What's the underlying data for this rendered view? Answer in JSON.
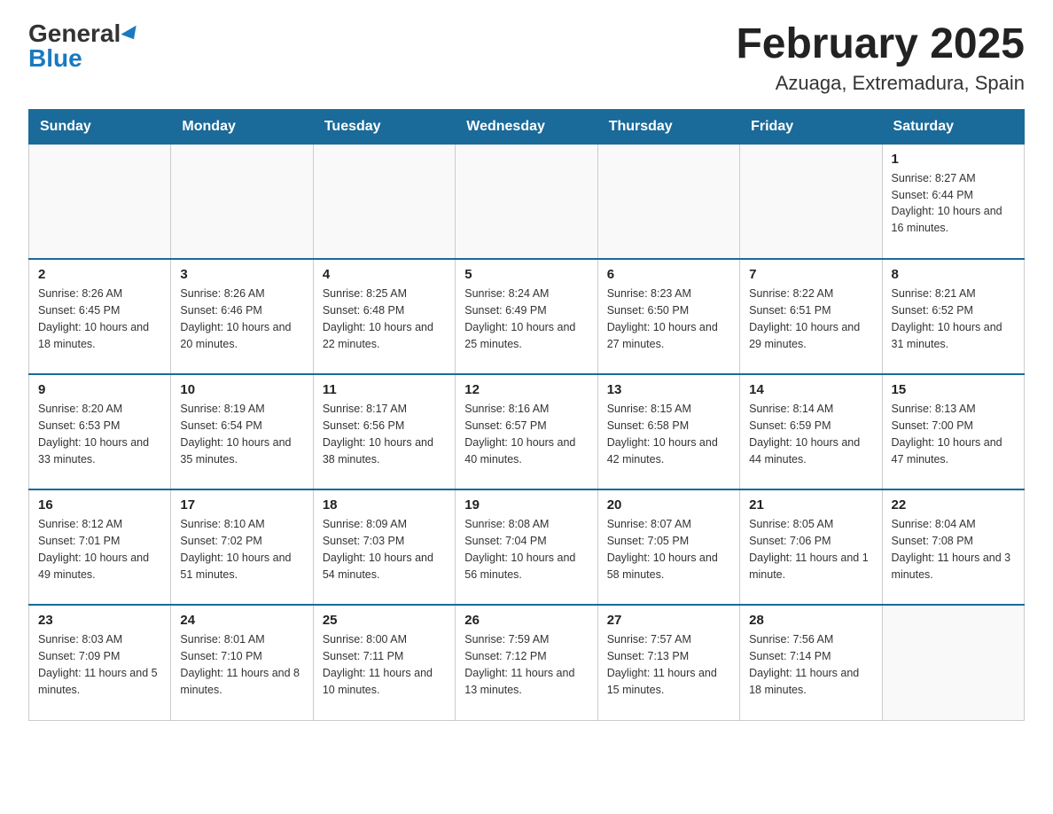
{
  "logo": {
    "general": "General",
    "blue": "Blue"
  },
  "title": "February 2025",
  "location": "Azuaga, Extremadura, Spain",
  "weekdays": [
    "Sunday",
    "Monday",
    "Tuesday",
    "Wednesday",
    "Thursday",
    "Friday",
    "Saturday"
  ],
  "weeks": [
    [
      {
        "day": "",
        "info": ""
      },
      {
        "day": "",
        "info": ""
      },
      {
        "day": "",
        "info": ""
      },
      {
        "day": "",
        "info": ""
      },
      {
        "day": "",
        "info": ""
      },
      {
        "day": "",
        "info": ""
      },
      {
        "day": "1",
        "info": "Sunrise: 8:27 AM\nSunset: 6:44 PM\nDaylight: 10 hours and 16 minutes."
      }
    ],
    [
      {
        "day": "2",
        "info": "Sunrise: 8:26 AM\nSunset: 6:45 PM\nDaylight: 10 hours and 18 minutes."
      },
      {
        "day": "3",
        "info": "Sunrise: 8:26 AM\nSunset: 6:46 PM\nDaylight: 10 hours and 20 minutes."
      },
      {
        "day": "4",
        "info": "Sunrise: 8:25 AM\nSunset: 6:48 PM\nDaylight: 10 hours and 22 minutes."
      },
      {
        "day": "5",
        "info": "Sunrise: 8:24 AM\nSunset: 6:49 PM\nDaylight: 10 hours and 25 minutes."
      },
      {
        "day": "6",
        "info": "Sunrise: 8:23 AM\nSunset: 6:50 PM\nDaylight: 10 hours and 27 minutes."
      },
      {
        "day": "7",
        "info": "Sunrise: 8:22 AM\nSunset: 6:51 PM\nDaylight: 10 hours and 29 minutes."
      },
      {
        "day": "8",
        "info": "Sunrise: 8:21 AM\nSunset: 6:52 PM\nDaylight: 10 hours and 31 minutes."
      }
    ],
    [
      {
        "day": "9",
        "info": "Sunrise: 8:20 AM\nSunset: 6:53 PM\nDaylight: 10 hours and 33 minutes."
      },
      {
        "day": "10",
        "info": "Sunrise: 8:19 AM\nSunset: 6:54 PM\nDaylight: 10 hours and 35 minutes."
      },
      {
        "day": "11",
        "info": "Sunrise: 8:17 AM\nSunset: 6:56 PM\nDaylight: 10 hours and 38 minutes."
      },
      {
        "day": "12",
        "info": "Sunrise: 8:16 AM\nSunset: 6:57 PM\nDaylight: 10 hours and 40 minutes."
      },
      {
        "day": "13",
        "info": "Sunrise: 8:15 AM\nSunset: 6:58 PM\nDaylight: 10 hours and 42 minutes."
      },
      {
        "day": "14",
        "info": "Sunrise: 8:14 AM\nSunset: 6:59 PM\nDaylight: 10 hours and 44 minutes."
      },
      {
        "day": "15",
        "info": "Sunrise: 8:13 AM\nSunset: 7:00 PM\nDaylight: 10 hours and 47 minutes."
      }
    ],
    [
      {
        "day": "16",
        "info": "Sunrise: 8:12 AM\nSunset: 7:01 PM\nDaylight: 10 hours and 49 minutes."
      },
      {
        "day": "17",
        "info": "Sunrise: 8:10 AM\nSunset: 7:02 PM\nDaylight: 10 hours and 51 minutes."
      },
      {
        "day": "18",
        "info": "Sunrise: 8:09 AM\nSunset: 7:03 PM\nDaylight: 10 hours and 54 minutes."
      },
      {
        "day": "19",
        "info": "Sunrise: 8:08 AM\nSunset: 7:04 PM\nDaylight: 10 hours and 56 minutes."
      },
      {
        "day": "20",
        "info": "Sunrise: 8:07 AM\nSunset: 7:05 PM\nDaylight: 10 hours and 58 minutes."
      },
      {
        "day": "21",
        "info": "Sunrise: 8:05 AM\nSunset: 7:06 PM\nDaylight: 11 hours and 1 minute."
      },
      {
        "day": "22",
        "info": "Sunrise: 8:04 AM\nSunset: 7:08 PM\nDaylight: 11 hours and 3 minutes."
      }
    ],
    [
      {
        "day": "23",
        "info": "Sunrise: 8:03 AM\nSunset: 7:09 PM\nDaylight: 11 hours and 5 minutes."
      },
      {
        "day": "24",
        "info": "Sunrise: 8:01 AM\nSunset: 7:10 PM\nDaylight: 11 hours and 8 minutes."
      },
      {
        "day": "25",
        "info": "Sunrise: 8:00 AM\nSunset: 7:11 PM\nDaylight: 11 hours and 10 minutes."
      },
      {
        "day": "26",
        "info": "Sunrise: 7:59 AM\nSunset: 7:12 PM\nDaylight: 11 hours and 13 minutes."
      },
      {
        "day": "27",
        "info": "Sunrise: 7:57 AM\nSunset: 7:13 PM\nDaylight: 11 hours and 15 minutes."
      },
      {
        "day": "28",
        "info": "Sunrise: 7:56 AM\nSunset: 7:14 PM\nDaylight: 11 hours and 18 minutes."
      },
      {
        "day": "",
        "info": ""
      }
    ]
  ]
}
